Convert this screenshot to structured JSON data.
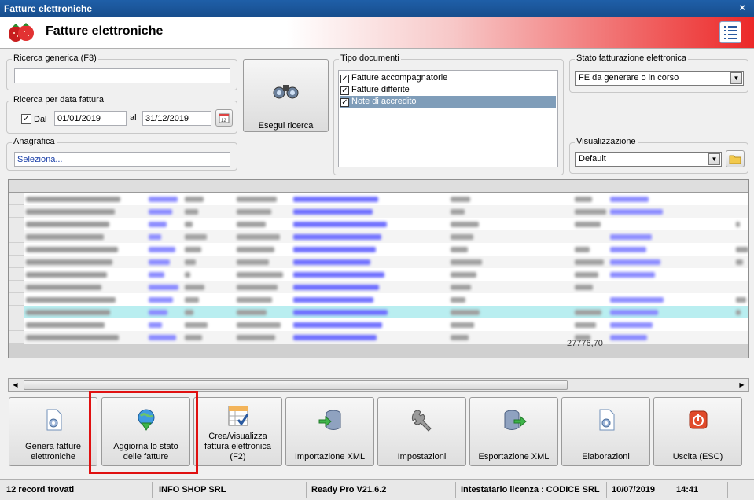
{
  "window": {
    "title": "Fatture elettroniche",
    "close_glyph": "×"
  },
  "header": {
    "title": "Fatture elettroniche",
    "logo_icon": "strawberry-logo-icon",
    "menu_icon": "list-menu-icon"
  },
  "search": {
    "generic_label": "Ricerca generica (F3)",
    "generic_value": "",
    "date_group_label": "Ricerca per data fattura",
    "from_label": "Dal",
    "from_checked": true,
    "from_value": "01/01/2019",
    "to_label": "al",
    "to_value": "31/12/2019",
    "calendar_icon": "calendar-icon",
    "anagrafica_label": "Anagrafica",
    "anagrafica_value": "Seleziona...",
    "search_button_label": "Esegui ricerca",
    "search_button_icon": "binoculars-icon"
  },
  "doc_types": {
    "label": "Tipo documenti",
    "items": [
      {
        "label": "Fatture accompagnatorie",
        "checked": true,
        "selected": false
      },
      {
        "label": "Fatture differite",
        "checked": true,
        "selected": false
      },
      {
        "label": "Note di accredito",
        "checked": true,
        "selected": true
      }
    ]
  },
  "fe_status": {
    "label": "Stato fatturazione elettronica",
    "value": "FE da generare o in corso"
  },
  "view": {
    "label": "Visualizzazione",
    "value": "Default",
    "folder_icon": "folder-icon"
  },
  "grid": {
    "total": "27776,70",
    "row_count": 12
  },
  "toolbar": [
    {
      "label": "Genera fatture elettroniche",
      "icon": "generate-document-icon"
    },
    {
      "label": "Aggiorna lo stato delle fatture",
      "icon": "update-globe-icon"
    },
    {
      "label": "Crea/visualizza fattura elettronica (F2)",
      "icon": "create-invoice-icon"
    },
    {
      "label": "Importazione XML",
      "icon": "database-import-icon"
    },
    {
      "label": "Impostazioni",
      "icon": "wrench-icon"
    },
    {
      "label": "Esportazione XML",
      "icon": "database-export-icon"
    },
    {
      "label": "Elaborazioni",
      "icon": "processing-icon"
    },
    {
      "label": "Uscita (ESC)",
      "icon": "exit-icon"
    }
  ],
  "status": {
    "records": "12 record trovati",
    "company": "INFO SHOP SRL",
    "version": "Ready Pro V21.6.2",
    "license": "Intestatario licenza : CODICE SRL",
    "date": "10/07/2019",
    "time": "14:41"
  },
  "colors": {
    "title_blue": "#1f5fa8",
    "header_red": "#ec2828",
    "highlight_row": "#b9eef0",
    "callout_red": "#e01010"
  }
}
